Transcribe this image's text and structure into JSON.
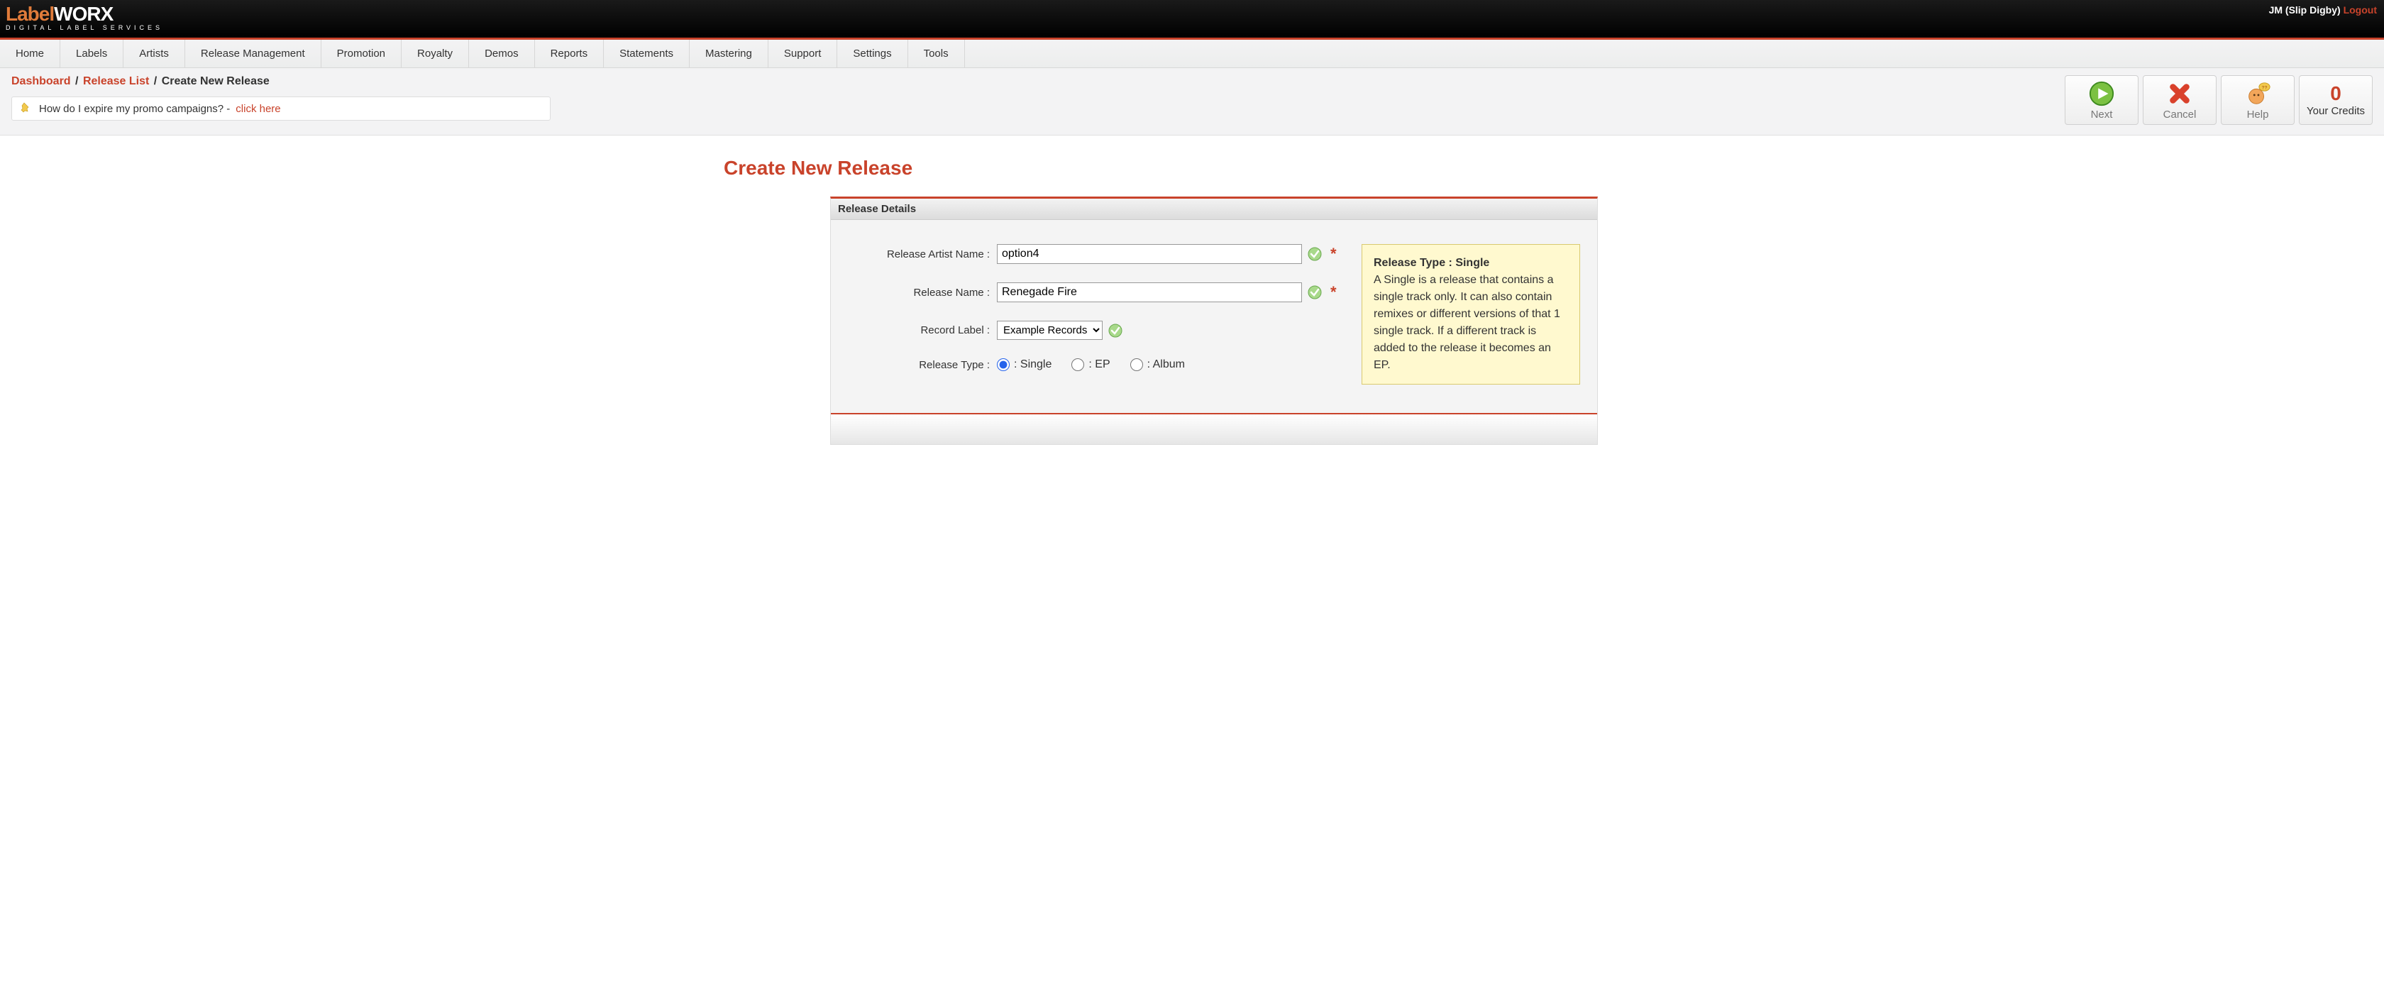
{
  "brand": {
    "label": "Label",
    "worx": "WORX",
    "sub": "DIGITAL LABEL SERVICES"
  },
  "user": {
    "name": "JM (Slip Digby)",
    "logout": "Logout"
  },
  "nav": [
    "Home",
    "Labels",
    "Artists",
    "Release Management",
    "Promotion",
    "Royalty",
    "Demos",
    "Reports",
    "Statements",
    "Mastering",
    "Support",
    "Settings",
    "Tools"
  ],
  "breadcrumb": {
    "dashboard": "Dashboard",
    "release_list": "Release List",
    "current": "Create New Release",
    "sep": "/"
  },
  "hint": {
    "text": "How do I expire my promo campaigns? - ",
    "link": "click here"
  },
  "actions": {
    "next": "Next",
    "cancel": "Cancel",
    "help": "Help",
    "credits_label": "Your Credits",
    "credits_value": "0"
  },
  "page": {
    "title": "Create New Release",
    "panel_title": "Release Details",
    "labels": {
      "artist": "Release Artist Name :",
      "release_name": "Release Name :",
      "record_label": "Record Label :",
      "release_type": "Release Type :"
    },
    "values": {
      "artist": "option4",
      "release_name": "Renegade Fire",
      "record_label_selected": "Example Records",
      "release_type_selected": "single"
    },
    "radio": {
      "single": ": Single",
      "ep": ": EP",
      "album": ": Album"
    },
    "required": "*",
    "info": {
      "title": "Release Type : Single",
      "body": "A Single is a release that contains a single track only. It can also contain remixes or different versions of that 1 single track. If a different track is added to the release it becomes an EP."
    }
  }
}
